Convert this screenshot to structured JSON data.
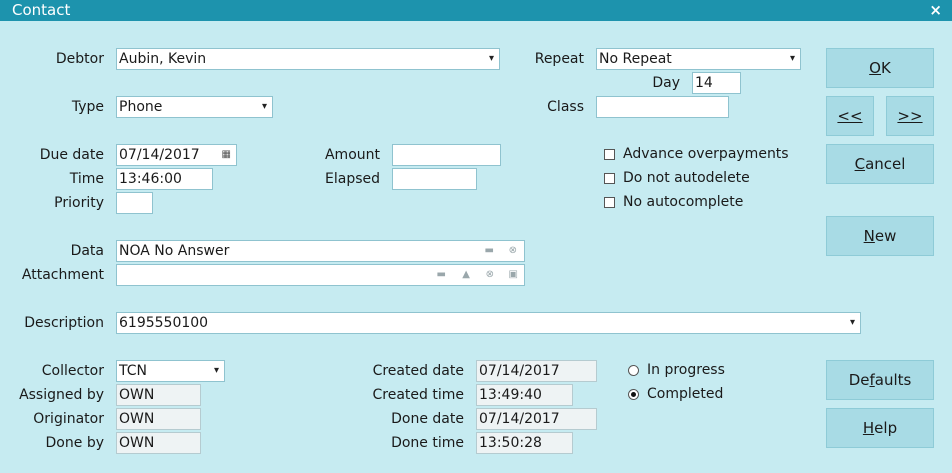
{
  "window": {
    "title": "Contact",
    "close_glyph": "×"
  },
  "labels": {
    "debtor": "Debtor",
    "type": "Type",
    "due_date": "Due date",
    "time": "Time",
    "priority": "Priority",
    "amount": "Amount",
    "elapsed": "Elapsed",
    "repeat": "Repeat",
    "day": "Day",
    "class": "Class",
    "data": "Data",
    "attachment": "Attachment",
    "description": "Description",
    "collector": "Collector",
    "assigned_by": "Assigned by",
    "originator": "Originator",
    "done_by": "Done by",
    "created_date": "Created date",
    "created_time": "Created time",
    "done_date": "Done date",
    "done_time": "Done time"
  },
  "fields": {
    "debtor": "Aubin, Kevin",
    "type": "Phone",
    "due_date": "07/14/2017",
    "time": "13:46:00",
    "priority": "",
    "amount": "",
    "elapsed": "",
    "repeat": "No Repeat",
    "day": "14",
    "class": "",
    "data": "NOA No Answer",
    "attachment": "",
    "description": "6195550100",
    "collector": "TCN",
    "assigned_by": "OWN",
    "originator": "OWN",
    "done_by": "OWN",
    "created_date": "07/14/2017",
    "created_time": "13:49:40",
    "done_date": "07/14/2017",
    "done_time": "13:50:28"
  },
  "checkboxes": {
    "advance_overpayments": {
      "label": "Advance overpayments",
      "checked": false
    },
    "do_not_autodelete": {
      "label": "Do not autodelete",
      "checked": false
    },
    "no_autocomplete": {
      "label": "No autocomplete",
      "checked": false
    }
  },
  "status": {
    "in_progress": {
      "label": "In progress",
      "selected": false
    },
    "completed": {
      "label": "Completed",
      "selected": true
    }
  },
  "buttons": {
    "ok": {
      "pre": "",
      "key": "O",
      "post": "K"
    },
    "prev": {
      "pre": "",
      "key": "<<",
      "post": ""
    },
    "next": {
      "pre": "",
      "key": ">>",
      "post": ""
    },
    "cancel": {
      "pre": "",
      "key": "C",
      "post": "ancel"
    },
    "new": {
      "pre": "",
      "key": "N",
      "post": "ew"
    },
    "defaults": {
      "pre": "De",
      "key": "f",
      "post": "aults"
    },
    "help": {
      "pre": "",
      "key": "H",
      "post": "elp"
    }
  },
  "icons": {
    "dropdown": "▾",
    "calendar": "▦",
    "folder": "▬",
    "clear": "⊗",
    "print": "▲",
    "user": "▣"
  },
  "colors": {
    "background": "#c6ebf1",
    "titlebar": "#1d93ad",
    "button": "#a8dbe5"
  }
}
